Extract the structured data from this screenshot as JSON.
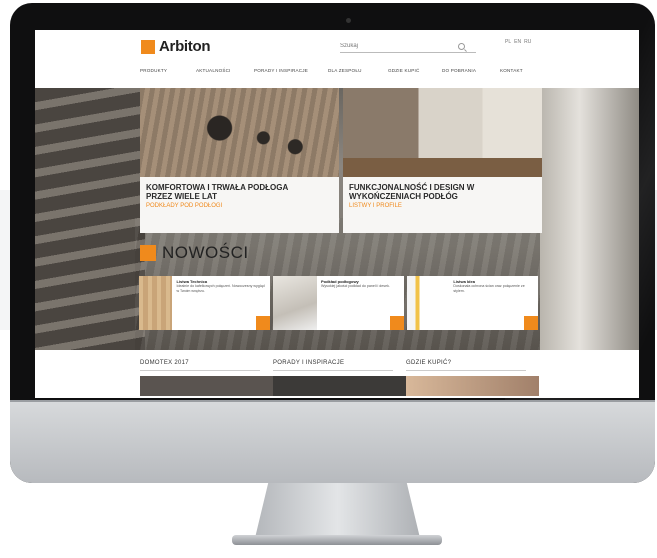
{
  "site": {
    "logo_text": "Arbiton",
    "search_placeholder": "Szukaj",
    "languages": [
      "PL",
      "EN",
      "RU"
    ],
    "nav": [
      "PRODUKTY",
      "AKTUALNOŚCI",
      "PORADY I INSPIRACJE",
      "DLA ZESPOŁU",
      "GDZIE KUPIĆ",
      "DO POBRANIA",
      "KONTAKT"
    ]
  },
  "hero_cards": [
    {
      "title_line1": "KOMFORTOWA I TRWAŁA PODŁOGA",
      "title_line2": "PRZEZ WIELE LAT",
      "link": "PODKŁADY POD PODŁOGI"
    },
    {
      "title_line1": "FUNKCJONALNOŚĆ I DESIGN W",
      "title_line2": "WYKOŃCZENIACH PODŁÓG",
      "link": "LISTWY I PROFILE"
    }
  ],
  "section": {
    "title": "NOWOŚCI"
  },
  "news": [
    {
      "heading": "Listwa Technica",
      "text": "Idealnie do kafelkowych połączeń. Nowoczesny wygląd w Twoim wnętrzu."
    },
    {
      "heading": "Podkład podłogowy",
      "text": "Wysokiej jakości podkład do paneli i desek."
    },
    {
      "heading": "Listwa Idea",
      "text": "Doskonała ochrona ścian oraz połączenie ze stylem."
    }
  ],
  "footer_cols": [
    "DOMOTEX 2017",
    "PORADY I INSPIRACJE",
    "GDZIE KUPIĆ?"
  ],
  "colors": {
    "accent": "#f08a1c",
    "bezel": "#0f0f10"
  }
}
